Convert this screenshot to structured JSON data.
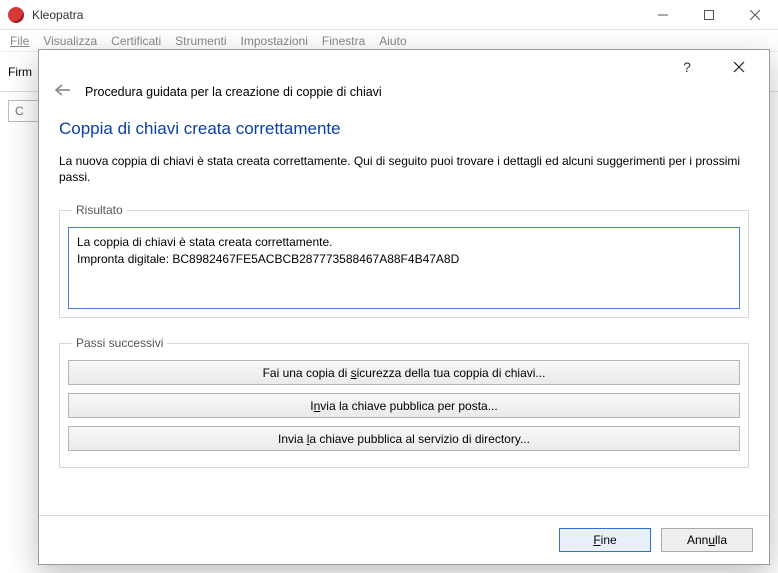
{
  "window": {
    "title": "Kleopatra"
  },
  "menu": {
    "file": "File",
    "view": "Visualizza",
    "certs": "Certificati",
    "tools": "Strumenti",
    "settings": "Impostazioni",
    "window": "Finestra",
    "help": "Aiuto"
  },
  "toolbar": {
    "left_label": "Firm",
    "chevron": "»"
  },
  "search": {
    "placeholder": "C",
    "icon_label": "⌕"
  },
  "dialog": {
    "wizard_title": "Procedura guidata per la creazione di coppie di chiavi",
    "heading": "Coppia di chiavi creata correttamente",
    "intro": "La nuova coppia di chiavi è stata creata correttamente. Qui di seguito puoi trovare i dettagli ed alcuni suggerimenti per i prossimi passi.",
    "result_legend": "Risultato",
    "result_line1": "La coppia di chiavi è stata creata correttamente.",
    "result_line2": "Impronta digitale: BC8982467FE5ACBCB287773588467A88F4B47A8D",
    "next_legend": "Passi successivi",
    "btn_backup_pre": "Fai una copia di ",
    "btn_backup_u": "s",
    "btn_backup_post": "icurezza della tua coppia di chiavi...",
    "btn_mail_pre": "I",
    "btn_mail_u": "n",
    "btn_mail_post": "via la chiave pubblica per posta...",
    "btn_dir_pre": "Invia ",
    "btn_dir_u": "l",
    "btn_dir_post": "a chiave pubblica al servizio di directory...",
    "finish_u": "F",
    "finish_post": "ine",
    "cancel_pre": "Ann",
    "cancel_u": "u",
    "cancel_post": "lla"
  }
}
